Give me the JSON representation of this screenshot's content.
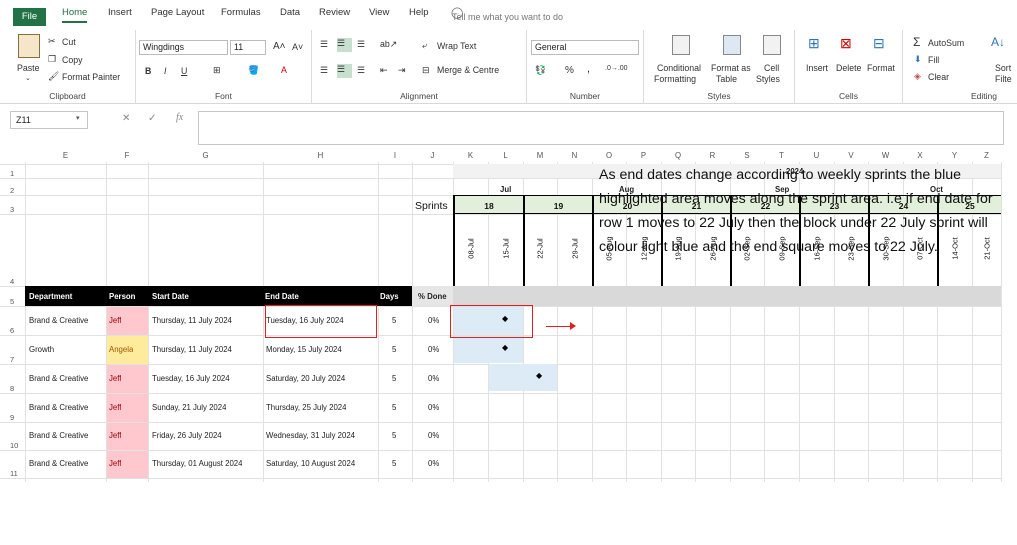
{
  "tabs": {
    "file": "File",
    "home": "Home",
    "insert": "Insert",
    "page_layout": "Page Layout",
    "formulas": "Formulas",
    "data": "Data",
    "review": "Review",
    "view": "View",
    "help": "Help",
    "tell_me": "Tell me what you want to do"
  },
  "ribbon": {
    "clipboard": {
      "paste": "Paste",
      "cut": "Cut",
      "copy": "Copy",
      "format_painter": "Format Painter",
      "label": "Clipboard"
    },
    "font": {
      "name": "Wingdings",
      "size": "11",
      "bold": "B",
      "italic": "I",
      "underline": "U",
      "label": "Font"
    },
    "alignment": {
      "wrap": "Wrap Text",
      "merge": "Merge & Centre",
      "label": "Alignment"
    },
    "number": {
      "format": "General",
      "percent": "%",
      "comma": ",",
      "label": "Number"
    },
    "styles": {
      "conditional": "Conditional",
      "formatting": "Formatting",
      "format_as": "Format as",
      "table": "Table",
      "cell": "Cell",
      "styles": "Styles",
      "label": "Styles"
    },
    "cells": {
      "insert": "Insert",
      "delete": "Delete",
      "format": "Format",
      "label": "Cells"
    },
    "editing": {
      "autosum": "AutoSum",
      "fill": "Fill",
      "clear": "Clear",
      "sort": "Sort",
      "filter": "Filte",
      "label": "Editing"
    }
  },
  "formula_bar": {
    "name_box": "Z11",
    "fx": "fx"
  },
  "columns": [
    "E",
    "F",
    "G",
    "H",
    "I",
    "J",
    "K",
    "L",
    "M",
    "N",
    "O",
    "P",
    "Q",
    "R",
    "S",
    "T",
    "U",
    "V",
    "W",
    "X",
    "Y",
    "Z"
  ],
  "rows": [
    "1",
    "2",
    "3",
    "4",
    "5",
    "6",
    "7",
    "8",
    "9",
    "10",
    "11"
  ],
  "year": "2024",
  "months": [
    "Jul",
    "Aug",
    "Sep",
    "Oct"
  ],
  "sprints_label": "Sprints",
  "sprints": [
    "18",
    "19",
    "20",
    "21",
    "22",
    "23",
    "24",
    "25"
  ],
  "dates": [
    "08-Jul",
    "15-Jul",
    "22-Jul",
    "29-Jul",
    "05-Aug",
    "12-Aug",
    "19-Aug",
    "26-Aug",
    "02-Sep",
    "09-Sep",
    "16-Sep",
    "23-Sep",
    "30-Sep",
    "07-Oct",
    "14-Oct",
    "21-Oct"
  ],
  "table_headers": {
    "department": "Department",
    "person": "Person",
    "start": "Start Date",
    "end": "End Date",
    "days": "Days",
    "done": "% Done"
  },
  "table_rows": [
    {
      "department": "Brand & Creative",
      "person": "Jeff",
      "start": "Thursday, 11 July 2024",
      "end": "Tuesday, 16 July 2024",
      "days": "5",
      "done": "0%"
    },
    {
      "department": "Growth",
      "person": "Angela",
      "start": "Thursday, 11 July 2024",
      "end": "Monday, 15 July 2024",
      "days": "5",
      "done": "0%"
    },
    {
      "department": "Brand & Creative",
      "person": "Jeff",
      "start": "Tuesday, 16 July 2024",
      "end": "Saturday, 20 July 2024",
      "days": "5",
      "done": "0%"
    },
    {
      "department": "Brand & Creative",
      "person": "Jeff",
      "start": "Sunday, 21 July 2024",
      "end": "Thursday, 25 July 2024",
      "days": "5",
      "done": "0%"
    },
    {
      "department": "Brand & Creative",
      "person": "Jeff",
      "start": "Friday, 26 July 2024",
      "end": "Wednesday, 31 July 2024",
      "days": "5",
      "done": "0%"
    },
    {
      "department": "Brand & Creative",
      "person": "Jeff",
      "start": "Thursday, 01 August 2024",
      "end": "Saturday, 10 August 2024",
      "days": "5",
      "done": "0%"
    }
  ],
  "marker": "◆",
  "annotation": "As end dates change according to weekly sprints the blue highlighted area moves along the sprint area. i.e if end date for row 1 moves to 22 July then the block under 22 July sprint will colour light blue and the end square moves to 22 July.",
  "colors": {
    "excel_green": "#217346",
    "sprint_fill": "#e2efda",
    "highlight_blue": "#ddebf7",
    "jeff_pink": "#ffc7ce",
    "angela_yellow": "#ffeb9c",
    "callout_red": "#e02020"
  }
}
